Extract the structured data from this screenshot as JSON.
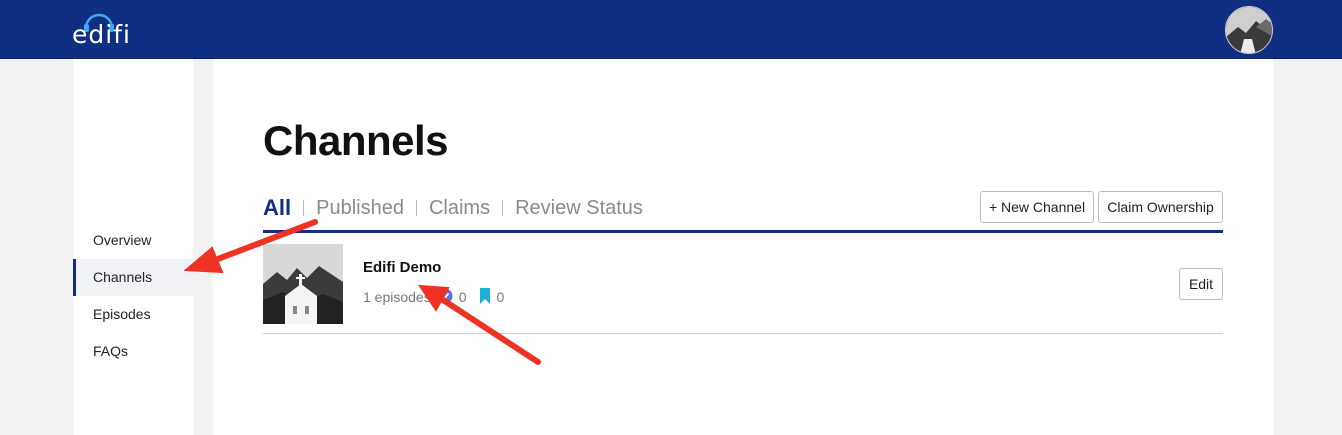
{
  "header": {
    "logo_text": "edifi",
    "colors": {
      "brand": "#0f2f82",
      "accent": "#3fa9f5"
    }
  },
  "sidebar": {
    "items": [
      {
        "label": "Overview"
      },
      {
        "label": "Channels",
        "active": true
      },
      {
        "label": "Episodes"
      },
      {
        "label": "FAQs"
      }
    ]
  },
  "main": {
    "title": "Channels",
    "tabs": [
      {
        "label": "All",
        "active": true
      },
      {
        "label": "Published"
      },
      {
        "label": "Claims"
      },
      {
        "label": "Review Status"
      }
    ],
    "actions": {
      "new_channel": "+ New Channel",
      "claim_ownership": "Claim Ownership"
    },
    "channels": [
      {
        "name": "Edifi Demo",
        "episodes_text": "1 episodes",
        "likes": "0",
        "bookmarks": "0",
        "edit_label": "Edit"
      }
    ]
  },
  "annotations": {
    "arrow_color": "#ee3224"
  }
}
